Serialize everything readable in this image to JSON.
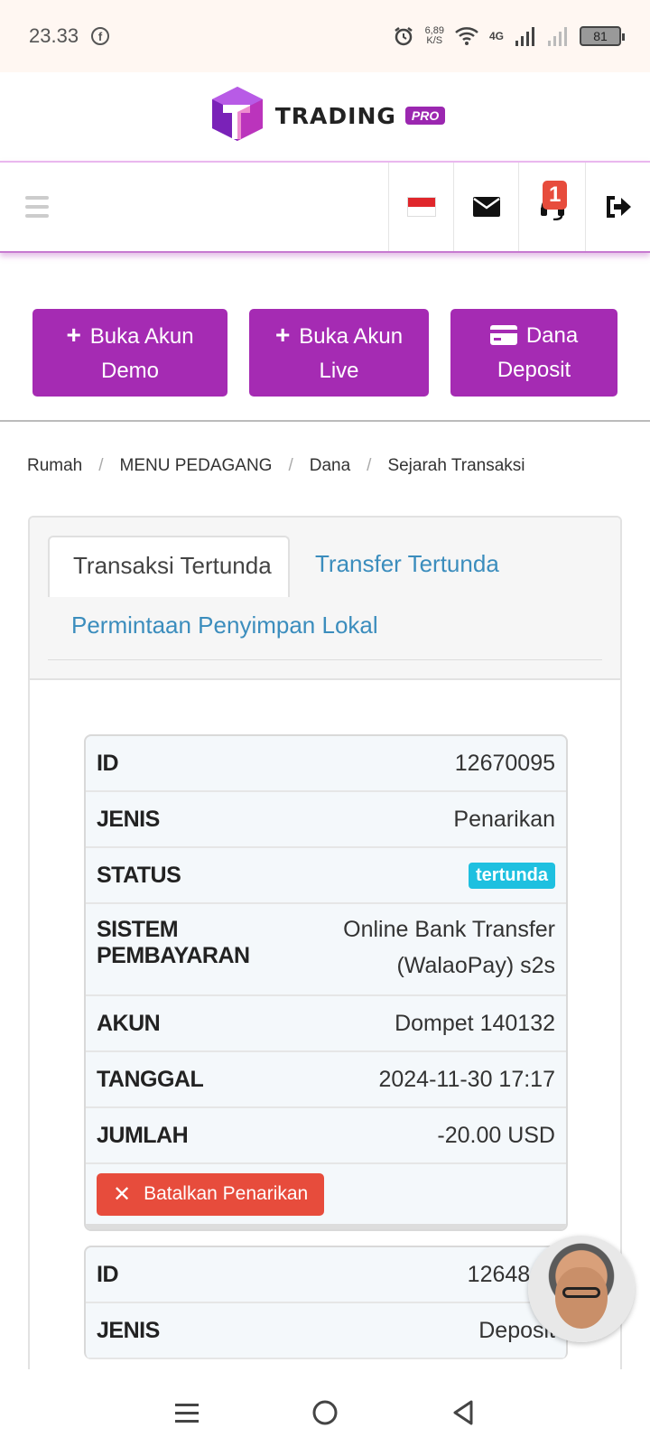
{
  "status_bar": {
    "time": "23.33",
    "net_speed_value": "6,89",
    "net_speed_unit": "K/S",
    "network": "4G",
    "battery": "81"
  },
  "brand": {
    "name": "TRADING",
    "badge": "PRO"
  },
  "nav": {
    "notification_count": "1"
  },
  "actions": [
    {
      "label": "Buka Akun Demo",
      "icon": "plus-icon"
    },
    {
      "label": "Buka Akun Live",
      "icon": "plus-icon"
    },
    {
      "label": "Dana Deposit",
      "icon": "credit-card-icon"
    }
  ],
  "breadcrumb": [
    "Rumah",
    "MENU PEDAGANG",
    "Dana",
    "Sejarah Transaksi"
  ],
  "breadcrumb_separator": "/",
  "tabs": [
    "Transaksi Tertunda",
    "Transfer Tertunda",
    "Permintaan Penyimpan Lokal"
  ],
  "transactions": [
    {
      "id_label": "ID",
      "id": "12670095",
      "type_label": "JENIS",
      "type": "Penarikan",
      "status_label": "STATUS",
      "status": "tertunda",
      "payment_label": "SISTEM PEMBAYARAN",
      "payment": "Online Bank Transfer (WalaoPay) s2s",
      "account_label": "AKUN",
      "account": "Dompet 140132",
      "date_label": "TANGGAL",
      "date": "2024-11-30 17:17",
      "amount_label": "JUMLAH",
      "amount": "-20.00 USD",
      "cancel_label": "Batalkan Penarikan"
    },
    {
      "id_label": "ID",
      "id": "1264814",
      "type_label": "JENIS",
      "type": "Deposit"
    }
  ],
  "colors": {
    "brand_purple": "#a52bb3",
    "status_pending": "#1ec0e0",
    "danger": "#e74c3c",
    "link": "#3b8dbd"
  }
}
